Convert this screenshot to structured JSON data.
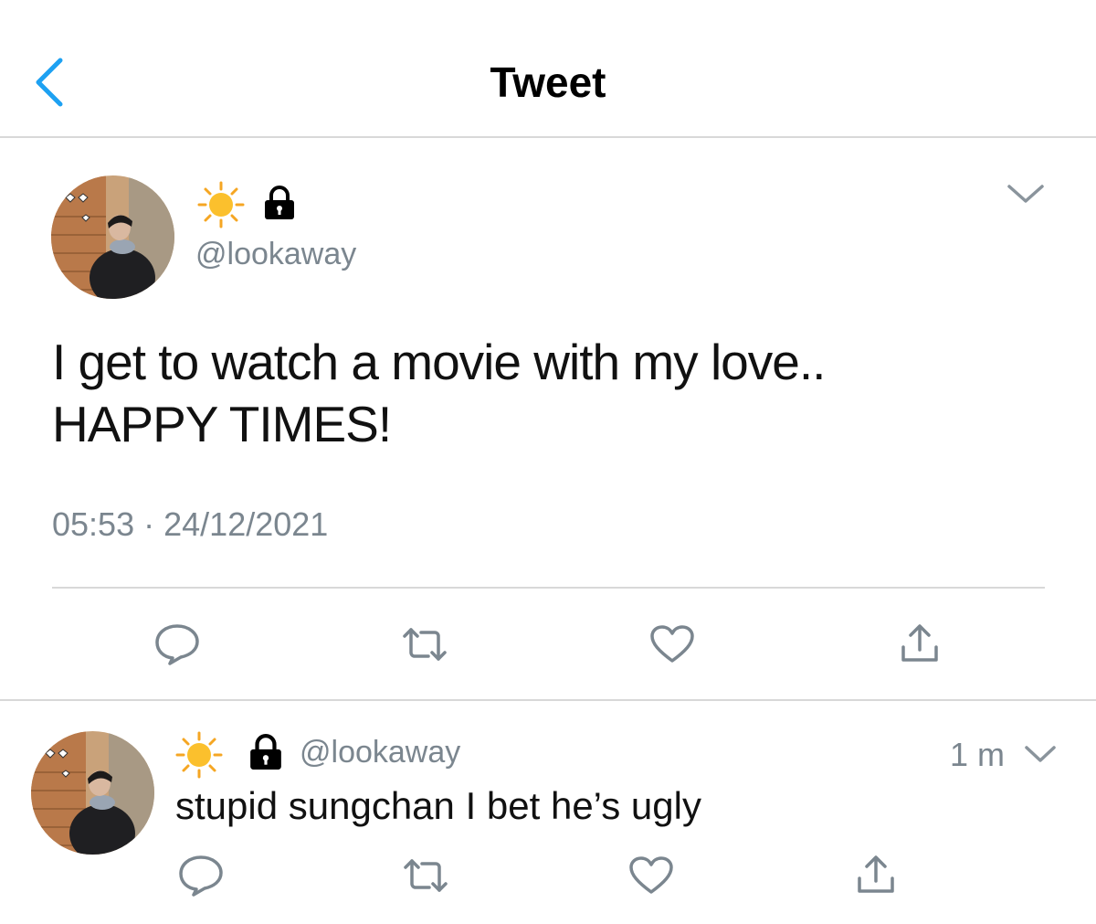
{
  "header": {
    "title": "Tweet",
    "back_icon": "chevron-left-icon"
  },
  "main_tweet": {
    "display_name_icons": [
      "sun-emoji-icon",
      "lock-icon"
    ],
    "handle": "@lookaway",
    "text_line1": "I get to watch a movie with my love..",
    "text_line2": "HAPPY TIMES!",
    "time": "05:53",
    "separator": "·",
    "date": "24/12/2021",
    "actions": [
      "reply-icon",
      "retweet-icon",
      "like-icon",
      "share-icon"
    ]
  },
  "reply_tweet": {
    "display_name_icons": [
      "sun-emoji-icon",
      "lock-icon"
    ],
    "handle": "@lookaway",
    "time_ago": "1 m",
    "text": "stupid sungchan I bet he’s ugly",
    "actions": [
      "reply-icon",
      "retweet-icon",
      "like-icon",
      "share-icon"
    ]
  },
  "colors": {
    "accent": "#1da1f2",
    "secondary_text": "#7b868f",
    "divider": "#d8d8d8",
    "icon": "#7b868f"
  }
}
